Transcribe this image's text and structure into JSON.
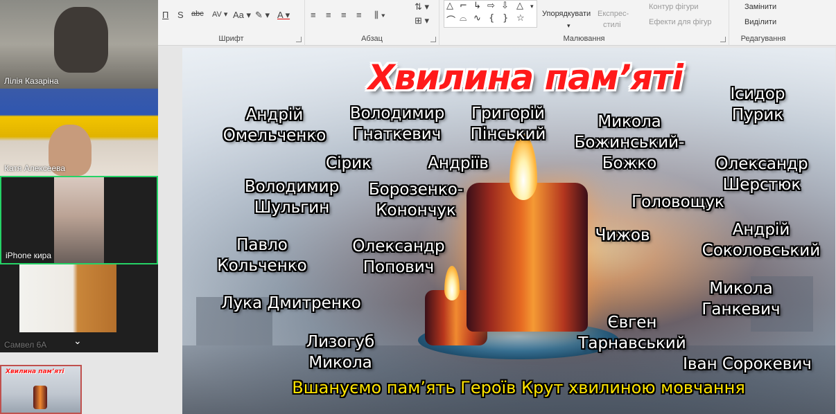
{
  "ribbon": {
    "groups": {
      "font": "Шрифт",
      "paragraph": "Абзац",
      "drawing": "Малювання",
      "editing": "Редагування"
    },
    "arrange_label": "Упорядкувати",
    "quick_styles_line1": "Експрес-",
    "quick_styles_line2": "стилі",
    "shape_outline": "Контур фігури",
    "shape_effects": "Ефекти для фігур",
    "replace": "Замінити",
    "select": "Виділити"
  },
  "participants": [
    {
      "name": "Лілія Казаріна"
    },
    {
      "name": "Катя Алексеева"
    },
    {
      "name": "iPhone кира"
    },
    {
      "name": "Самвел 6А"
    }
  ],
  "slide": {
    "title": "Хвилина пам’яті",
    "names": [
      "Андрій\nОмельченко",
      "Володимир\nГнаткевич",
      "Григорій\nПінський",
      "Микола\nБожинський-\nБожко",
      "Ісидор\nПурик",
      "Сірик",
      "Андріїв",
      "Олександр\nШерстюк",
      "Володимир\nШульгин",
      "Борозенко-\nКонончук",
      "Головощук",
      "Павло\nКольченко",
      "Олександр\nПопович",
      "Чижов",
      "Андрій\nСоколовський",
      "Лука Дмитренко",
      "Микола\nГанкевич",
      "Євген\nТарнавський",
      "Лизогуб\nМикола",
      "Іван Сорокевич"
    ],
    "footer": "Вшануємо пам’ять Героїв Крут хвилиною мовчання"
  },
  "thumbnail": {
    "title": "Хвилина пам’яті"
  },
  "colors": {
    "title_red": "#ff1a1a",
    "footer_yellow": "#ffe400",
    "active_tile_border": "#25d366"
  }
}
